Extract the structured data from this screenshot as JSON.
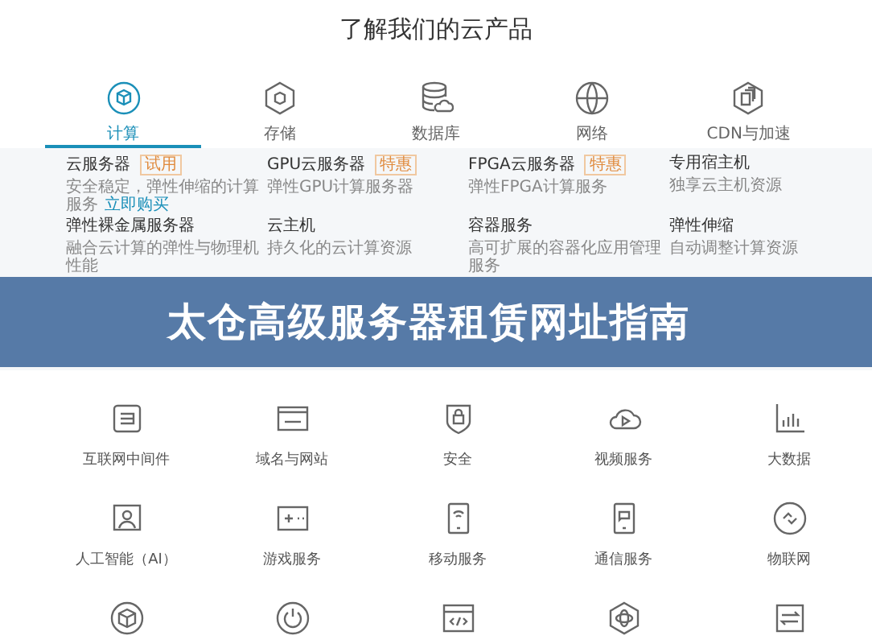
{
  "title": "了解我们的云产品",
  "tabs": [
    {
      "label": "计算",
      "selected": true
    },
    {
      "label": "存储",
      "selected": false
    },
    {
      "label": "数据库",
      "selected": false
    },
    {
      "label": "网络",
      "selected": false
    },
    {
      "label": "CDN与加速",
      "selected": false
    }
  ],
  "products": [
    {
      "name": "云服务器",
      "badge": "试用",
      "desc": "安全稳定，弹性伸缩的计算服务",
      "link": "立即购买"
    },
    {
      "name": "GPU云服务器",
      "badge": "特惠",
      "desc": "弹性GPU计算服务器"
    },
    {
      "name": "FPGA云服务器",
      "badge": "特惠",
      "desc": "弹性FPGA计算服务"
    },
    {
      "name": "专用宿主机",
      "desc": "独享云主机资源"
    },
    {
      "name": "弹性裸金属服务器",
      "desc": "融合云计算的弹性与物理机性能"
    },
    {
      "name": "云主机",
      "desc": "持久化的云计算资源"
    },
    {
      "name": "容器服务",
      "desc": "高可扩展的容器化应用管理服务"
    },
    {
      "name": "弹性伸缩",
      "desc": "自动调整计算资源"
    }
  ],
  "banner": "太仓高级服务器租赁网址指南",
  "categories": [
    {
      "label": "互联网中间件"
    },
    {
      "label": "域名与网站"
    },
    {
      "label": "安全"
    },
    {
      "label": "视频服务"
    },
    {
      "label": "大数据"
    },
    {
      "label": "人工智能（AI）"
    },
    {
      "label": "游戏服务"
    },
    {
      "label": "移动服务"
    },
    {
      "label": "通信服务"
    },
    {
      "label": "物联网"
    }
  ]
}
